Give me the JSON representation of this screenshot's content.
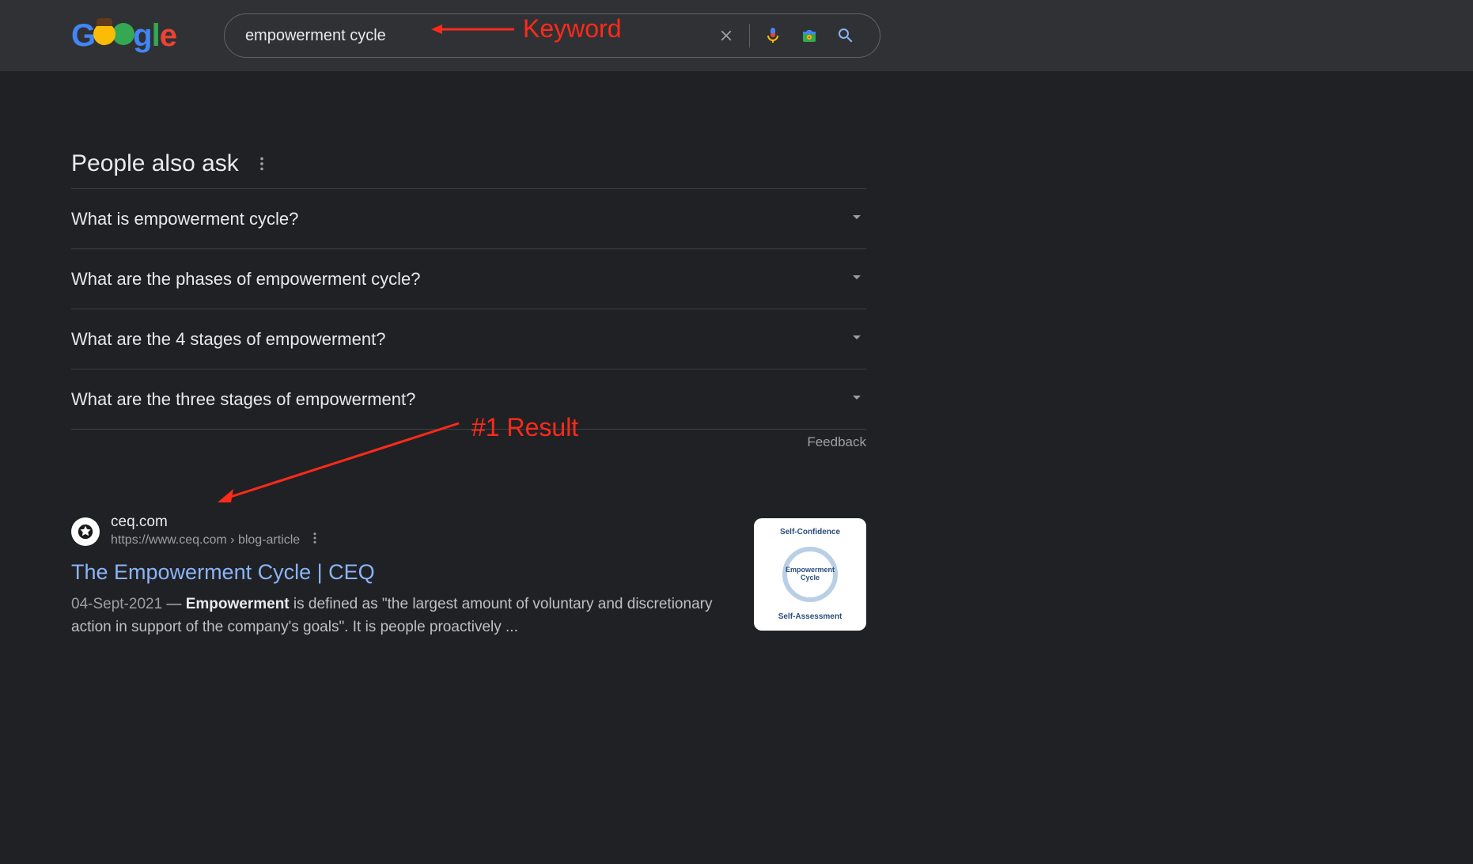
{
  "search": {
    "query": "empowerment cycle"
  },
  "paa": {
    "title": "People also ask",
    "items": [
      "What is empowerment cycle?",
      "What are the phases of empowerment cycle?",
      "What are the 4 stages of empowerment?",
      "What are the three stages of empowerment?"
    ],
    "feedback": "Feedback"
  },
  "result": {
    "site_name": "ceq.com",
    "url_display": "https://www.ceq.com › blog-article",
    "title": "The Empowerment Cycle | CEQ",
    "date": "04-Sept-2021",
    "snippet_sep": " — ",
    "snippet_bold": "Empowerment",
    "snippet_rest": " is defined as \"the largest amount of voluntary and discretionary action in support of the company's goals\". It is people proactively ...",
    "thumb": {
      "top": "Self-Confidence",
      "center": "Empowerment Cycle",
      "bottom": "Self-Assessment"
    }
  },
  "annotations": {
    "keyword": "Keyword",
    "result": "#1 Result"
  }
}
